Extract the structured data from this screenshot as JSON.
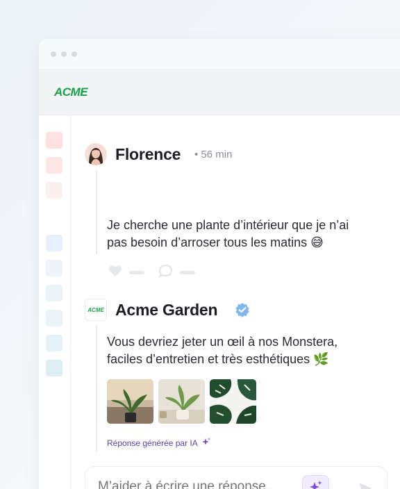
{
  "brand": {
    "logo_text": "ACME",
    "logo_color": "#17a34a"
  },
  "sidebar": {
    "blocks": [
      {
        "color": "#fde0df"
      },
      {
        "color": "#fde6e4"
      },
      {
        "color": "#fdf1ef"
      },
      {
        "color": "#e6f0fc"
      },
      {
        "color": "#eef4fa"
      },
      {
        "color": "#ebf5f7"
      },
      {
        "color": "#eaf4f6"
      },
      {
        "color": "#e4f1f8"
      },
      {
        "color": "#dcedf4"
      }
    ]
  },
  "post": {
    "author": "Florence",
    "time": "• 56 min",
    "text_line1": "Je cherche une plante d’intérieur que je n’ai",
    "text_line2": "pas besoin d’arroser tous les matins 😅",
    "actions": [
      "heart-icon",
      "comment-icon"
    ]
  },
  "reply": {
    "author": "Acme Garden",
    "avatar_text": "ACME",
    "verified": true,
    "text_line1": "Vous devriez jeter un œil à nos Monstera,",
    "text_line2": "faciles d’entretien et très esthétiques 🌿",
    "images": [
      "plant-photo-1",
      "plant-photo-2",
      "monstera-leaves-photo"
    ],
    "ai_label": "Réponse générée par IA"
  },
  "composer": {
    "placeholder": "M’aider à écrire une réponse...",
    "ai_button_icon": "sparkles-icon",
    "send_icon": "send-icon"
  },
  "colors": {
    "accent_purple": "#7c4ddb",
    "verified_blue": "#5aa2f0"
  }
}
